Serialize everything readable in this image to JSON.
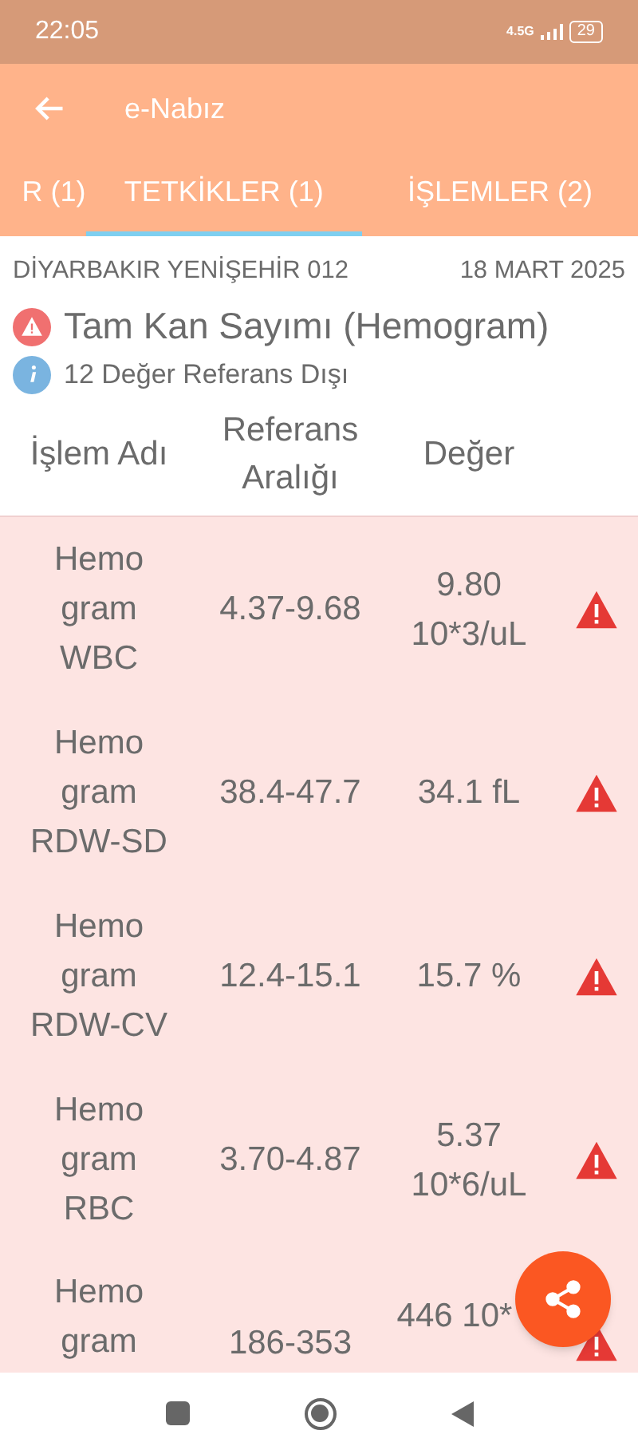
{
  "status_bar": {
    "time": "22:05",
    "battery": "29",
    "network": "4.5G"
  },
  "app_bar": {
    "title": "e-Nabız"
  },
  "tabs": [
    {
      "label": "R (1)",
      "selected": false
    },
    {
      "label": "TETKİKLER (1)",
      "selected": true
    },
    {
      "label": "İŞLEMLER (2)",
      "selected": false
    }
  ],
  "header": {
    "institution": "DİYARBAKIR YENİŞEHİR 012",
    "date": "18 MART 2025",
    "test_title": "Tam Kan Sayımı (Hemogram)",
    "note": "12 Değer Referans Dışı"
  },
  "table": {
    "columns": [
      "İşlem Adı",
      "Referans Aralığı",
      "Değer"
    ],
    "rows": [
      {
        "name": "Hemo gram WBC",
        "range": "4.37-9.68",
        "value": "9.80 10*3/uL",
        "out_of_range": true
      },
      {
        "name": "Hemo gram RDW-SD",
        "range": "38.4-47.7",
        "value": "34.1 fL",
        "out_of_range": true
      },
      {
        "name": "Hemo gram RDW-CV",
        "range": "12.4-15.1",
        "value": "15.7 %",
        "out_of_range": true
      },
      {
        "name": "Hemo gram RBC",
        "range": "3.70-4.87",
        "value": "5.37 10*6/uL",
        "out_of_range": true
      },
      {
        "name": "Hemo gram",
        "range": "186-353",
        "value": "446 10*",
        "out_of_range": true
      }
    ]
  }
}
